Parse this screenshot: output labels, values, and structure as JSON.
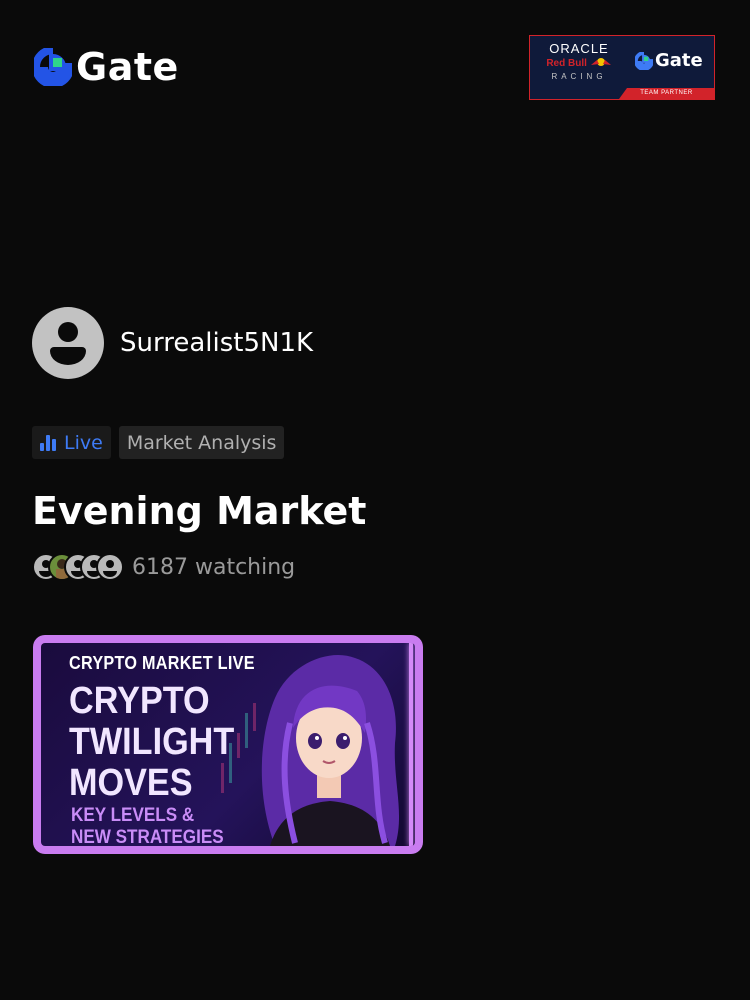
{
  "header": {
    "logo_text": "Gate",
    "logo_icon": "gate-logo-icon"
  },
  "partner": {
    "oracle": "ORACLE",
    "redbull": "Red Bull",
    "racing": "RACING",
    "gate": "Gate",
    "footer": "TEAM PARTNER"
  },
  "host": {
    "name": "Surrealist5N1K",
    "avatar_icon": "user-avatar-icon"
  },
  "tags": {
    "live": "Live",
    "live_icon": "bar-chart-icon",
    "category": "Market Analysis"
  },
  "stream": {
    "title": "Evening Market",
    "viewers": "6187 watching"
  },
  "thumbnail": {
    "subtitle": "CRYPTO MARKET LIVE",
    "headline_1": "CRYPTO",
    "headline_2": "TWILIGHT",
    "headline_3": "MOVES",
    "footer_1": "KEY LEVELS &",
    "footer_2": "NEW STRATEGIES"
  },
  "colors": {
    "background": "#0a0a0a",
    "accent_blue": "#3e7bf5",
    "gate_green": "#2fd48b",
    "thumb_border": "#c97cf0"
  }
}
